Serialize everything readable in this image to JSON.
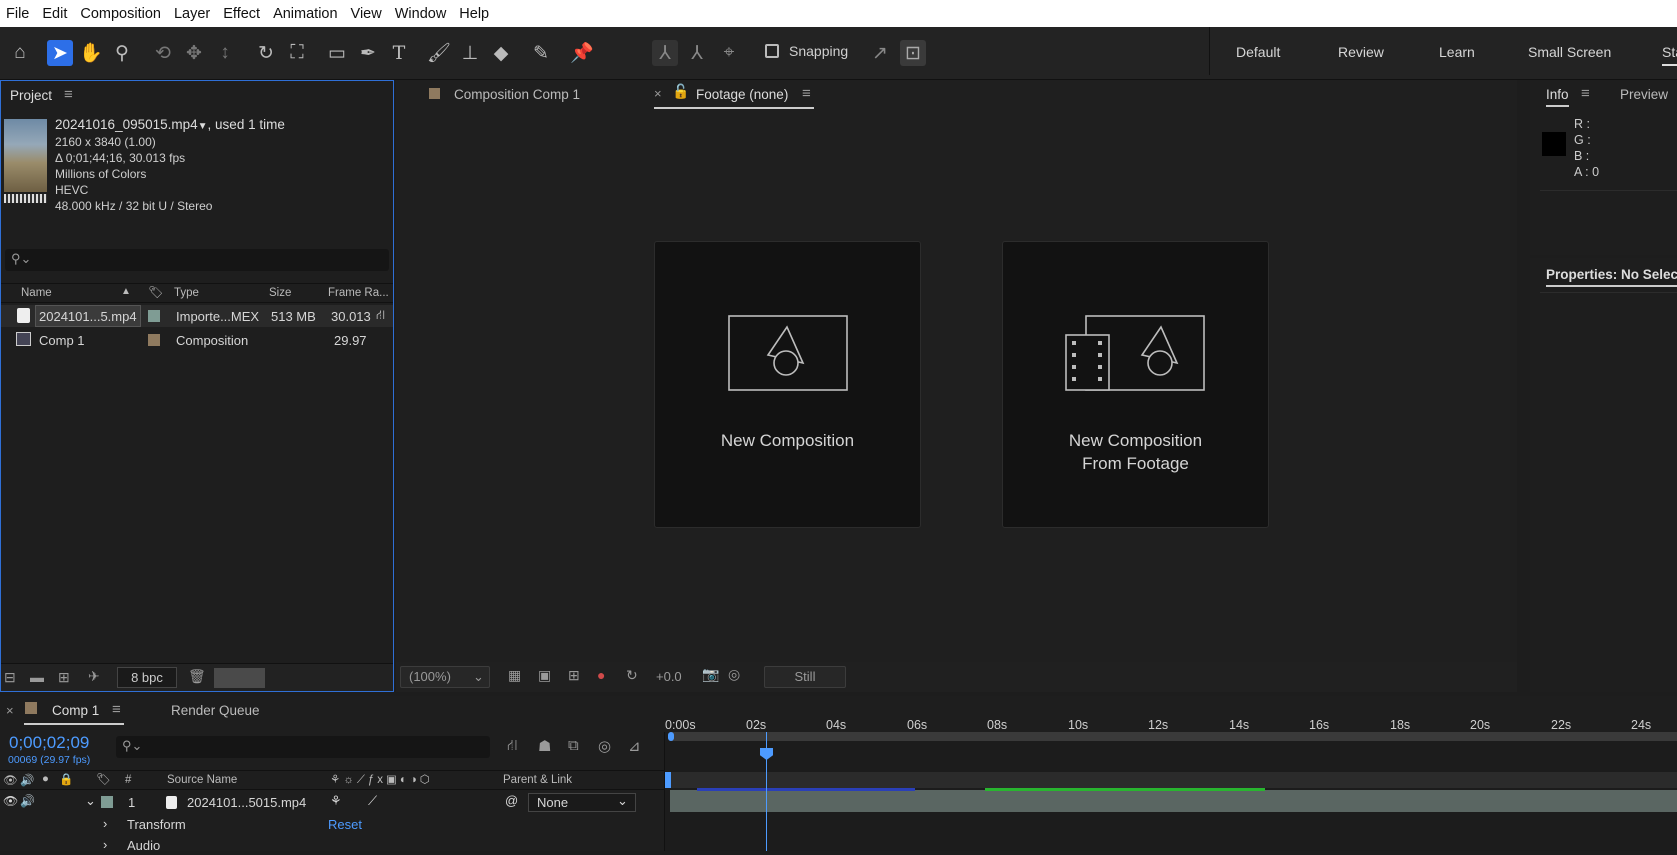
{
  "menu": [
    "File",
    "Edit",
    "Composition",
    "Layer",
    "Effect",
    "Animation",
    "View",
    "Window",
    "Help"
  ],
  "toolbar": {
    "snapping_label": "Snapping",
    "workspaces": [
      "Default",
      "Review",
      "Learn",
      "Small Screen",
      "Sta"
    ]
  },
  "project": {
    "tab": "Project",
    "file_name": "20241016_095015.mp4",
    "used": ", used 1 time",
    "info_lines": [
      "2160 x 3840 (1.00)",
      "Δ 0;01;44;16, 30.013 fps",
      "Millions of Colors",
      "HEVC",
      "48.000 kHz / 32 bit U / Stereo"
    ],
    "search_placeholder": "",
    "columns": [
      "Name",
      "Type",
      "Size",
      "Frame Ra..."
    ],
    "rows": [
      {
        "name": "2024101...5.mp4",
        "type": "Importe...MEX",
        "size": "513 MB",
        "fps": "30.013",
        "label_color": "#7f9c94"
      },
      {
        "name": "Comp 1",
        "type": "Composition",
        "size": "",
        "fps": "29.97",
        "label_color": "#8f7a5f"
      }
    ],
    "bpc": "8 bpc"
  },
  "viewer": {
    "tab_comp": "Composition Comp 1",
    "tab_footage": "Footage (none)",
    "card1": "New Composition",
    "card2_line1": "New Composition",
    "card2_line2": "From Footage",
    "zoom": "(100%)",
    "exposure": "+0.0",
    "still": "Still"
  },
  "info": {
    "tab": "Info",
    "tab2": "Preview",
    "r": "R :",
    "g": "G :",
    "b": "B :",
    "a": "A :  0",
    "props": "Properties: No Selecti"
  },
  "timeline": {
    "tab_comp": "Comp 1",
    "tab_render": "Render Queue",
    "timecode": "0;00;02;09",
    "frame_info": "00069 (29.97 fps)",
    "col_num": "#",
    "col_source": "Source Name",
    "col_parent": "Parent & Link",
    "layer_num": "1",
    "layer_name": "2024101...5015.mp4",
    "parent_value": "None",
    "transform": "Transform",
    "reset": "Reset",
    "audio": "Audio",
    "ticks": [
      "0:00s",
      "02s",
      "04s",
      "06s",
      "08s",
      "10s",
      "12s",
      "14s",
      "16s",
      "18s",
      "20s",
      "22s",
      "24s"
    ]
  },
  "colors": {
    "accent": "#2d6fe8",
    "timecode": "#4d9bff",
    "green_bar": "#28b52f",
    "blue_bar": "#2a3fb8"
  }
}
